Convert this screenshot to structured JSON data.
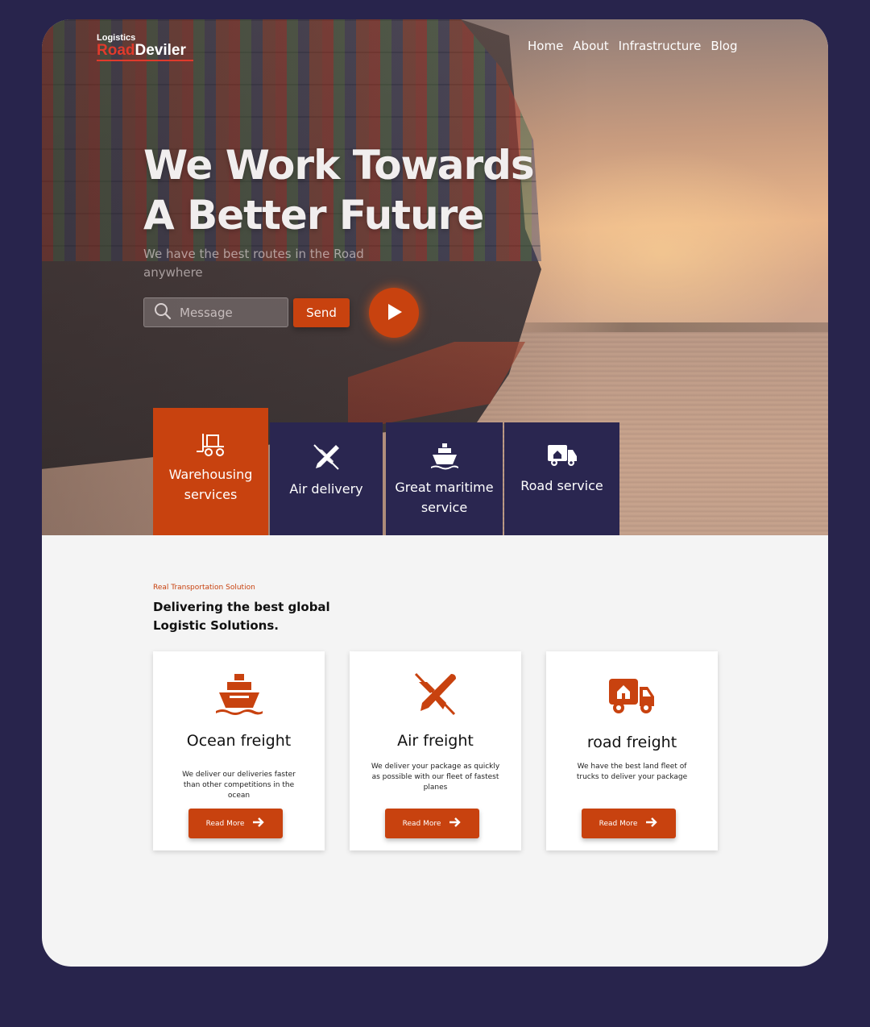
{
  "brand": {
    "tagline": "Logistics",
    "name_accent": "Road",
    "name_rest": "Deviler"
  },
  "nav": {
    "items": [
      "Home",
      "About",
      "Infrastructure",
      "Blog"
    ]
  },
  "hero": {
    "title_line1": "We Work Towards",
    "title_line2": "A Better Future",
    "subtitle": "We have the best routes in the Road anywhere",
    "search_placeholder": "Message",
    "send_label": "Send"
  },
  "services": [
    {
      "icon": "forklift-icon",
      "label_line1": "Warehousing",
      "label_line2": "services",
      "active": true
    },
    {
      "icon": "airplane-icon",
      "label_line1": "Air delivery",
      "label_line2": "",
      "active": false
    },
    {
      "icon": "ship-icon",
      "label_line1": "Great maritime",
      "label_line2": "service",
      "active": false
    },
    {
      "icon": "truck-icon",
      "label_line1": "Road service",
      "label_line2": "",
      "active": false
    }
  ],
  "section": {
    "kicker": "Real Transportation Solution",
    "title": "Delivering the best global Logistic Solutions."
  },
  "cards": [
    {
      "icon": "ship-icon",
      "title": "Ocean freight",
      "desc": "We deliver our deliveries faster than other competitions in the ocean",
      "button": "Read More"
    },
    {
      "icon": "airplane-icon",
      "title": "Air freight",
      "desc": "We deliver your package as quickly as possible with our fleet of fastest planes",
      "button": "Read More"
    },
    {
      "icon": "truck-icon",
      "title": "road freight",
      "desc": "We have the best land fleet of trucks to deliver your package",
      "button": "Read More"
    }
  ],
  "colors": {
    "accent": "#c8420f",
    "navy": "#2a2650",
    "background": "#28244c"
  }
}
